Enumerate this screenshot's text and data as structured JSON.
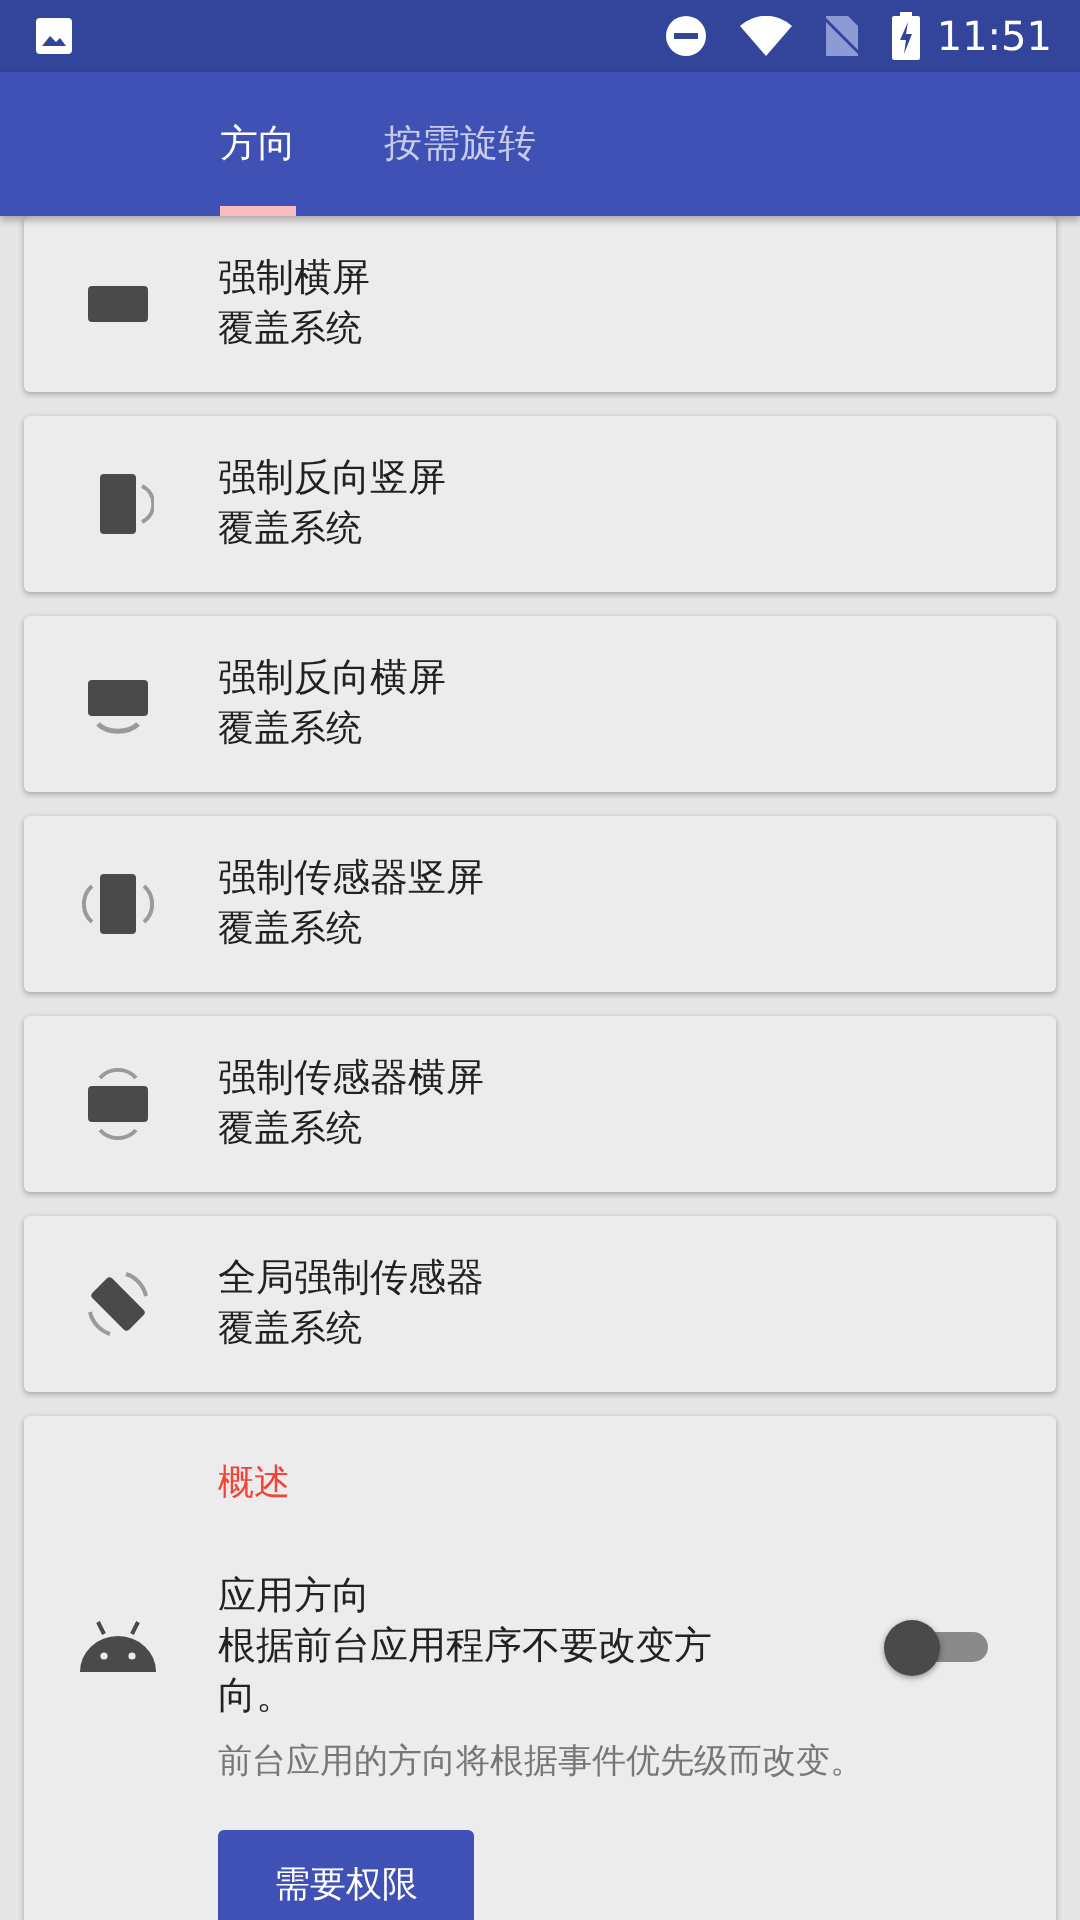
{
  "status_bar": {
    "time": "11:51"
  },
  "tabs": [
    {
      "label": "方向",
      "selected": true
    },
    {
      "label": "按需旋转",
      "selected": false
    }
  ],
  "modes": [
    {
      "kind": "landscape",
      "title": "强制横屏",
      "subtitle": "覆盖系统"
    },
    {
      "kind": "reverse-portrait",
      "title": "强制反向竖屏",
      "subtitle": "覆盖系统"
    },
    {
      "kind": "reverse-landscape",
      "title": "强制反向横屏",
      "subtitle": "覆盖系统"
    },
    {
      "kind": "sensor-portrait",
      "title": "强制传感器竖屏",
      "subtitle": "覆盖系统"
    },
    {
      "kind": "sensor-landscape",
      "title": "强制传感器横屏",
      "subtitle": "覆盖系统"
    },
    {
      "kind": "full-sensor",
      "title": "全局强制传感器",
      "subtitle": "覆盖系统"
    }
  ],
  "summary": {
    "header": "概述",
    "setting": {
      "title": "应用方向",
      "description": "根据前台应用程序不要改变方向。",
      "on": false
    },
    "note": "前台应用的方向将根据事件优先级而改变。",
    "button": "需要权限"
  }
}
